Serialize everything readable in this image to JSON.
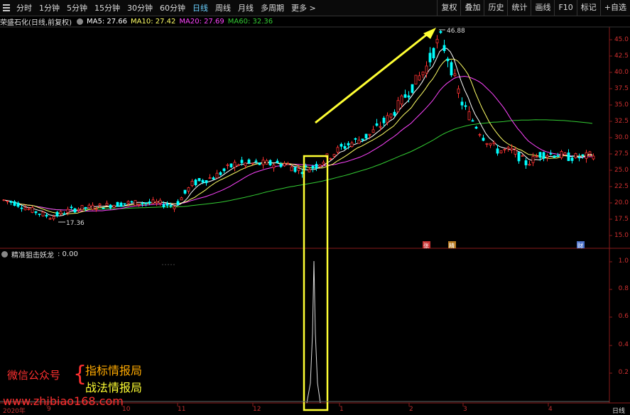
{
  "toolbar": {
    "periods": [
      "分时",
      "1分钟",
      "5分钟",
      "15分钟",
      "30分钟",
      "60分钟",
      "日线",
      "周线",
      "月线",
      "多周期",
      "更多 >"
    ],
    "active_period": "日线",
    "right_buttons": [
      "复权",
      "叠加",
      "历史",
      "统计",
      "画线",
      "F10",
      "标记",
      "+自选"
    ]
  },
  "info": {
    "stock": "荣盛石化(日线,前复权)",
    "ma5": "MA5: 27.66",
    "ma10": "MA10: 27.42",
    "ma20": "MA20: 27.69",
    "ma60": "MA60: 32.36"
  },
  "indicator": {
    "name": "精准狙击妖龙",
    "value": ": 0.00"
  },
  "price_axis": [
    "45.0",
    "42.5",
    "40.0",
    "37.5",
    "35.0",
    "32.5",
    "30.0",
    "27.5",
    "25.0",
    "22.5",
    "20.0",
    "17.5",
    "15.0"
  ],
  "indicator_axis": [
    "1.0",
    "0.8",
    "0.6",
    "0.4",
    "0.2"
  ],
  "annotations": {
    "high": "46.88",
    "low": "17.36",
    "badge_zhang": "张",
    "badge_jing": "精",
    "badge_cai": "财"
  },
  "dates": [
    "2020年",
    "9",
    "10",
    "11",
    "12",
    "1",
    "2",
    "3",
    "4"
  ],
  "period_label": "日线",
  "watermark": {
    "left": "微信公众号",
    "line1": "指标情报局",
    "line2": "战法情报局",
    "url": "www.zhibiao168.com"
  },
  "colors": {
    "up": "#ff3232",
    "down": "#00ffff",
    "ma5": "#ffffff",
    "ma10": "#ffff66",
    "ma20": "#ff44ff",
    "ma60": "#33cc33",
    "highlight": "#ffff33"
  }
}
